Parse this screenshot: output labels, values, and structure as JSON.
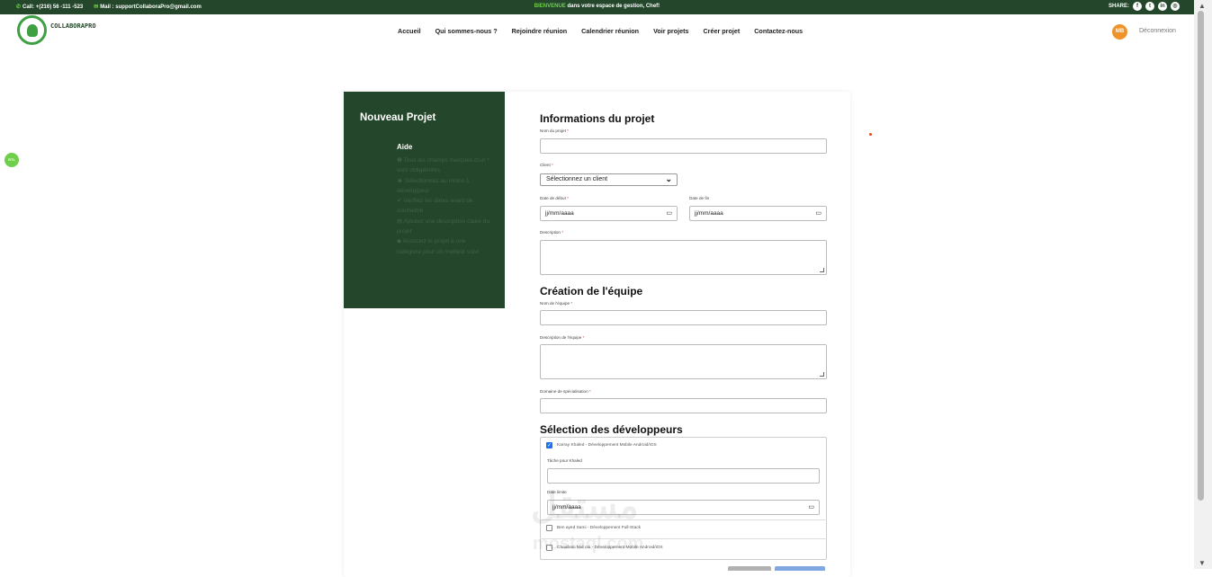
{
  "topbar": {
    "call": "Call: +(216) 56 -111 -523",
    "mail": "Mail : supportCollaboraPro@gmail.com",
    "welcome_hl": "BIENVENUE",
    "welcome_rest": " dans votre espace de gestion, Chef!",
    "share_label": "SHARE:",
    "social_icons": [
      "facebook-icon",
      "twitter-icon",
      "linkedin-icon",
      "dribbble-icon"
    ]
  },
  "brand": {
    "name": "COLLABORAPRO"
  },
  "nav": {
    "links": [
      "Accueil",
      "Qui sommes-nous ?",
      "Rejoindre réunion",
      "Calendrier réunion",
      "Voir projets",
      "Créer projet",
      "Contactez-nous"
    ],
    "avatar_initials": "MB",
    "logout": "Déconnexion"
  },
  "rtl_badge": "RTL",
  "sidebar": {
    "title": "Nouveau Projet",
    "help_title": "Aide",
    "tips": [
      "Tous les champs marqués d'un * sont obligatoires",
      "Sélectionnez au moins 1 développeur",
      "Vérifiez les dates avant de soumettre",
      "Ajoutez une description claire du projet",
      "Associez le projet à une catégorie pour un meilleur suivi"
    ],
    "tip_icons": [
      "info-icon",
      "users-icon",
      "check-icon",
      "file-icon",
      "tag-icon"
    ]
  },
  "project_info": {
    "title": "Informations du projet",
    "name_label": "Nom du projet",
    "client_label": "Client",
    "client_value": "Sélectionnez un client",
    "start_label": "Date de début",
    "end_label": "Date de fin",
    "date_placeholder": "jj/mm/aaaa",
    "desc_label": "Description"
  },
  "team": {
    "title": "Création de l'équipe",
    "name_label": "Nom de l'équipe",
    "desc_label": "Description de l'équipe",
    "domain_label": "Domaine de spécialisation"
  },
  "devs": {
    "title": "Sélection des développeurs",
    "list": [
      {
        "label": "Karray Khaled - Développement Mobile Android/iOS",
        "checked": true
      },
      {
        "label": "Ben ayed Sami - Développement Full-Stack",
        "checked": false
      },
      {
        "label": "Chaabani Mid ooi - Développement Mobile Android/iOS",
        "checked": false
      }
    ],
    "task_label": "Tâche pour Khaled",
    "deadline_label": "Date limite",
    "date_placeholder": "jj/mm/aaaa"
  },
  "required_mark": "*",
  "watermark": {
    "arabic": "مستقل",
    "latin": "mostaql.com"
  }
}
